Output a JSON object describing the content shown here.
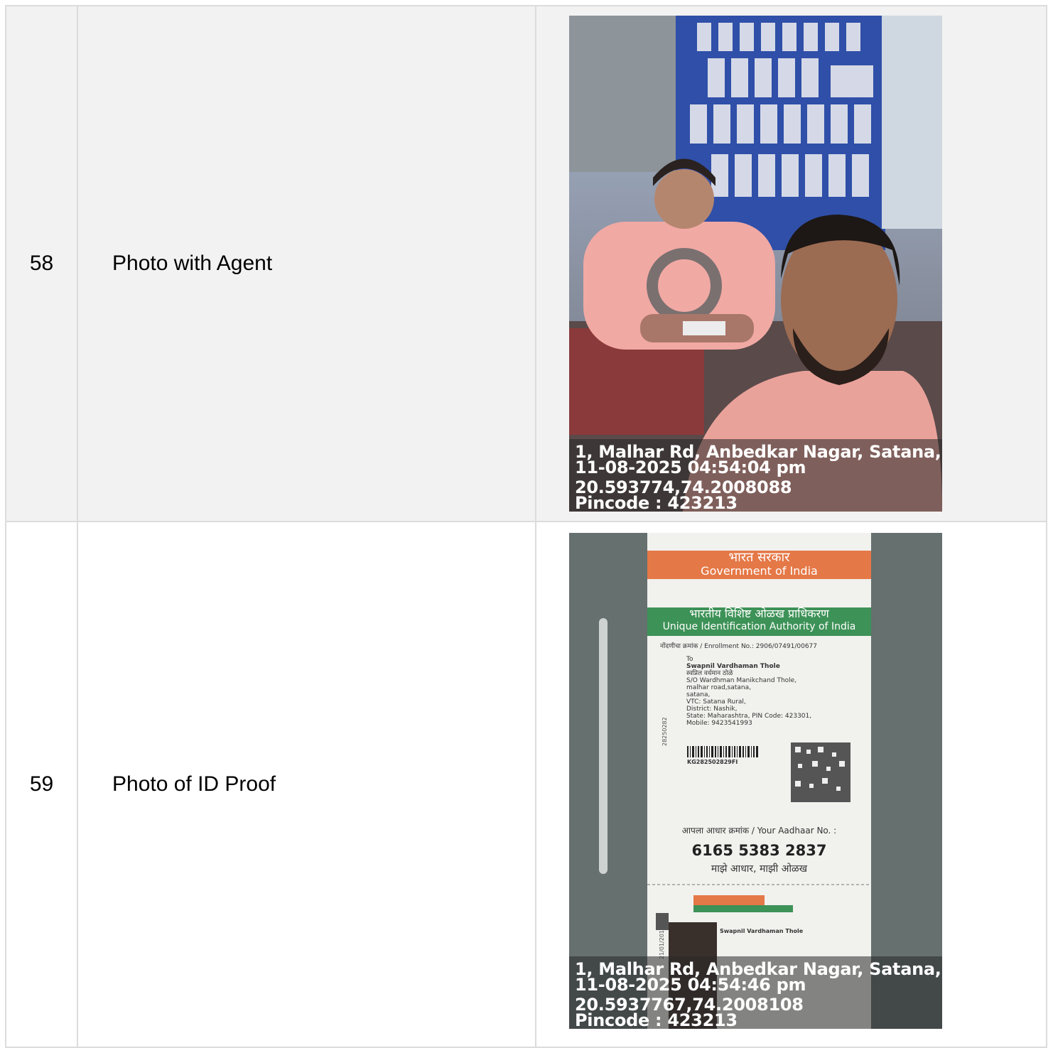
{
  "rows": [
    {
      "number": "58",
      "label": "Photo with Agent",
      "photo": {
        "address": "1, Malhar Rd, Anbedkar Nagar, Satana, ...",
        "datetime": "11-08-2025 04:54:04 pm",
        "coordinates": "20.593774,74.2008088",
        "pincode": "Pincode : 423213"
      }
    },
    {
      "number": "59",
      "label": "Photo of ID Proof",
      "photo": {
        "address": "1, Malhar Rd, Anbedkar Nagar, Satana, ...",
        "datetime": "11-08-2025 04:54:46 pm",
        "coordinates": "20.5937767,74.2008108",
        "pincode": "Pincode : 423213",
        "card": {
          "header_hi": "भारत सरकार",
          "header_en": "Government of India",
          "authority_hi": "भारतीय विशिष्ट ओळख प्राधिकरण",
          "authority_en": "Unique Identification Authority of India",
          "enrollment": "नोंदणीचा क्रमांक / Enrollment No.: 2906/07491/00677",
          "address_lines": [
            "To",
            "Swapnil Vardhaman Thole",
            "स्वप्निल वर्धमान ठोळे",
            "S/O Wardhman Manikchand Thole,",
            "malhar road,satana,",
            "satana,",
            "VTC: Satana Rural,",
            "District: Nashik,",
            "State: Maharashtra, PIN Code: 423301,",
            "Mobile: 9423541993"
          ],
          "barcode_text": "KG282502829FI",
          "your_aadhaar": "आपला आधार क्रमांक / Your Aadhaar No. :",
          "aadhaar_number": "6165 5383 2837",
          "tagline": "माझे आधार, माझी ओळख",
          "holder_name": "Swapnil Vardhaman Thole",
          "side_date": "21/01/2012",
          "side_code": "28250282"
        }
      }
    }
  ]
}
